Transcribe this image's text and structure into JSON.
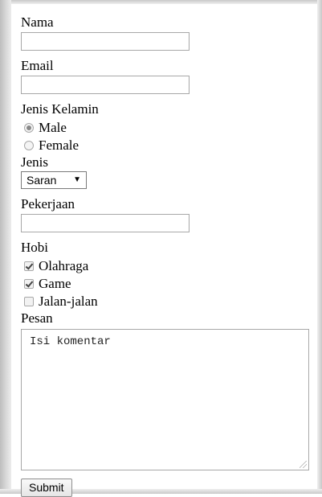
{
  "form": {
    "nama": {
      "label": "Nama",
      "value": ""
    },
    "email": {
      "label": "Email",
      "value": ""
    },
    "gender": {
      "label": "Jenis Kelamin",
      "options": [
        {
          "label": "Male",
          "selected": true
        },
        {
          "label": "Female",
          "selected": false
        }
      ]
    },
    "jenis": {
      "label": "Jenis",
      "selected": "Saran"
    },
    "pekerjaan": {
      "label": "Pekerjaan",
      "value": ""
    },
    "hobi": {
      "label": "Hobi",
      "options": [
        {
          "label": "Olahraga",
          "checked": true
        },
        {
          "label": "Game",
          "checked": true
        },
        {
          "label": "Jalan-jalan",
          "checked": false
        }
      ]
    },
    "pesan": {
      "label": "Pesan",
      "value": "Isi komentar"
    },
    "submit_label": "Submit"
  }
}
